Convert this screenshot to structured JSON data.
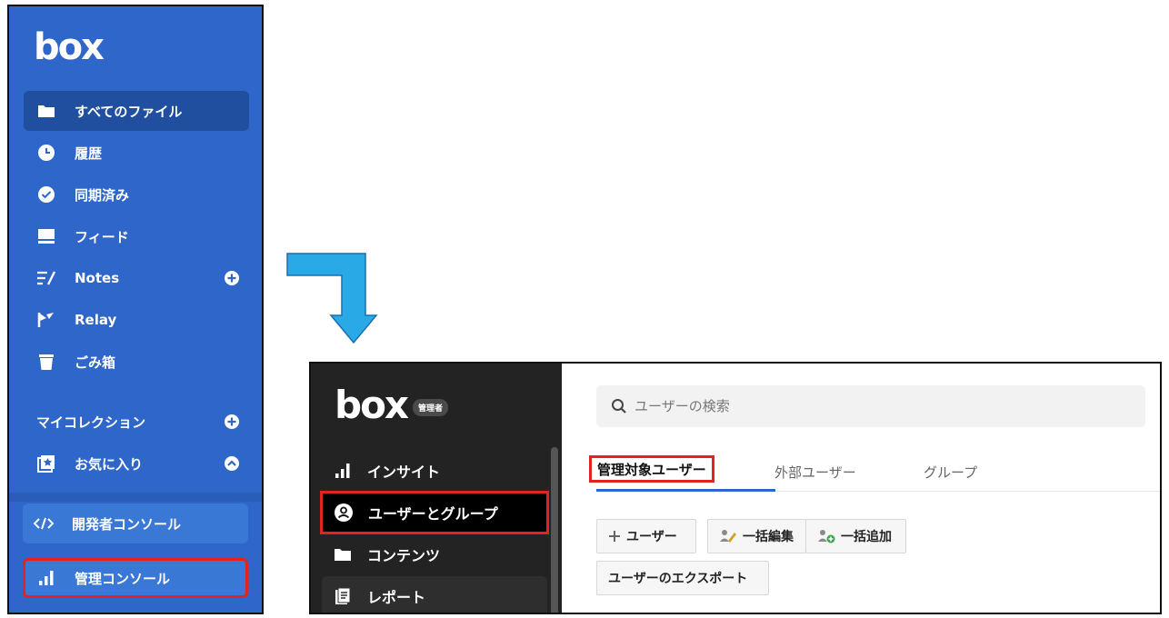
{
  "left_sidebar": {
    "logo": "box",
    "items": [
      {
        "label": "すべてのファイル",
        "icon": "folder-icon"
      },
      {
        "label": "履歴",
        "icon": "clock-icon"
      },
      {
        "label": "同期済み",
        "icon": "check-circle-icon"
      },
      {
        "label": "フィード",
        "icon": "feed-icon"
      },
      {
        "label": "Notes",
        "icon": "notes-icon"
      },
      {
        "label": "Relay",
        "icon": "relay-icon"
      },
      {
        "label": "ごみ箱",
        "icon": "trash-icon"
      },
      {
        "label": "マイコレクション",
        "icon": "plus-icon"
      },
      {
        "label": "お気に入り",
        "icon": "star-box-icon"
      }
    ],
    "developer_console": "開発者コンソール",
    "admin_console": "管理コンソール"
  },
  "admin_console": {
    "logo": "box",
    "badge": "管理者",
    "nav": [
      {
        "label": "インサイト",
        "icon": "bar-chart-icon"
      },
      {
        "label": "ユーザーとグループ",
        "icon": "user-circle-icon"
      },
      {
        "label": "コンテンツ",
        "icon": "folder-icon"
      },
      {
        "label": "レポート",
        "icon": "report-icon"
      }
    ],
    "search": {
      "placeholder": "ユーザーの検索"
    },
    "tabs": [
      "管理対象ユーザー",
      "外部ユーザー",
      "グループ"
    ],
    "buttons": {
      "add_user": "ユーザー",
      "bulk_edit": "一括編集",
      "bulk_add": "一括追加",
      "export_users": "ユーザーのエクスポート"
    }
  },
  "colors": {
    "sidebar_blue": "#2f66c9",
    "admin_dark": "#232323",
    "highlight_red": "#e52222",
    "arrow_blue": "#29a9e6"
  }
}
